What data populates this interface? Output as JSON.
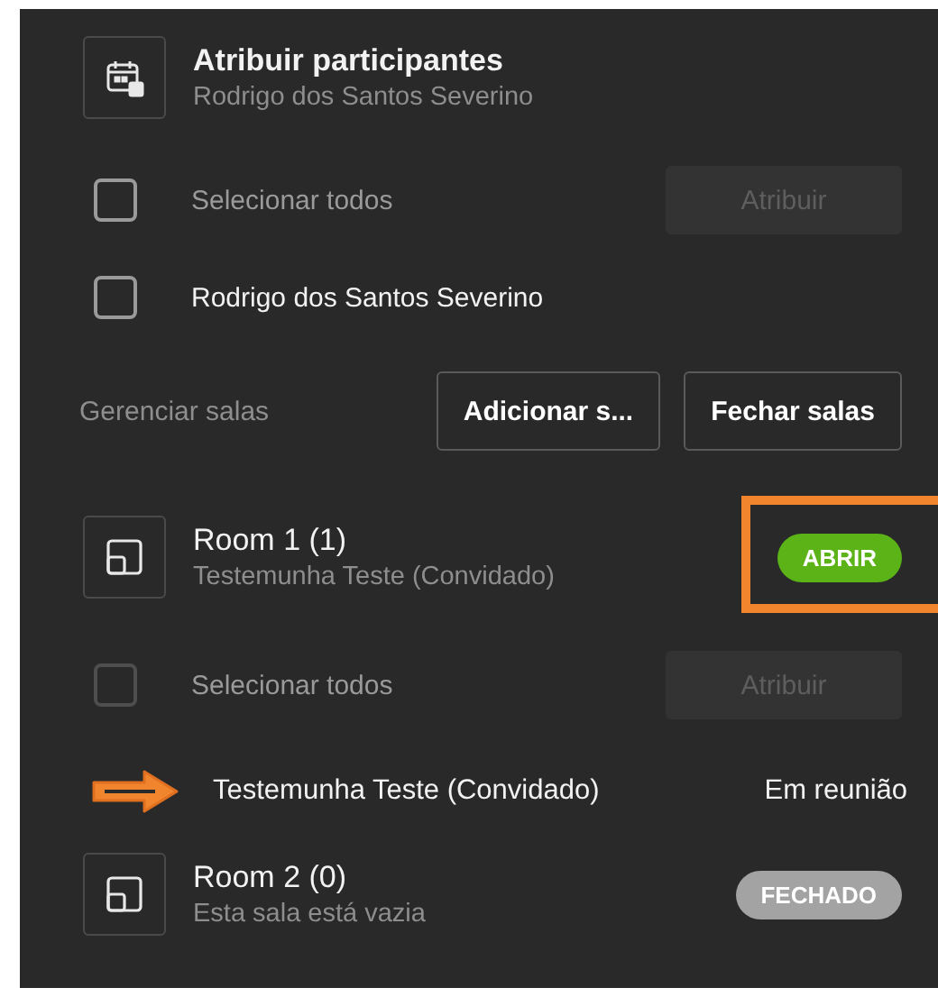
{
  "header": {
    "title": "Atribuir participantes",
    "subtitle": "Rodrigo dos Santos Severino"
  },
  "assign": {
    "select_all": {
      "label": "Selecionar todos",
      "checked": false,
      "disabled": false
    },
    "button": {
      "label": "Atribuir",
      "disabled": true
    },
    "participants": [
      {
        "name": "Rodrigo dos Santos Severino",
        "checked": false
      }
    ]
  },
  "manage": {
    "label": "Gerenciar salas",
    "buttons": [
      "Adicionar s...",
      "Fechar salas"
    ]
  },
  "rooms": [
    {
      "name": "Room 1 (1)",
      "subtitle": "Testemunha Teste (Convidado)",
      "kind": "open",
      "badge": "ABRIR",
      "highlighted": true,
      "select_all": {
        "label": "Selecionar todos",
        "checked": false,
        "disabled": true
      },
      "button": {
        "label": "Atribuir",
        "disabled": true
      },
      "participants": [
        {
          "name": "Testemunha Teste (Convidado)",
          "state": "Em reunião",
          "pointed": true
        }
      ]
    },
    {
      "name": "Room 2 (0)",
      "subtitle": "Esta sala está vazia",
      "kind": "closed",
      "badge": "FECHADO",
      "highlighted": false
    }
  ]
}
